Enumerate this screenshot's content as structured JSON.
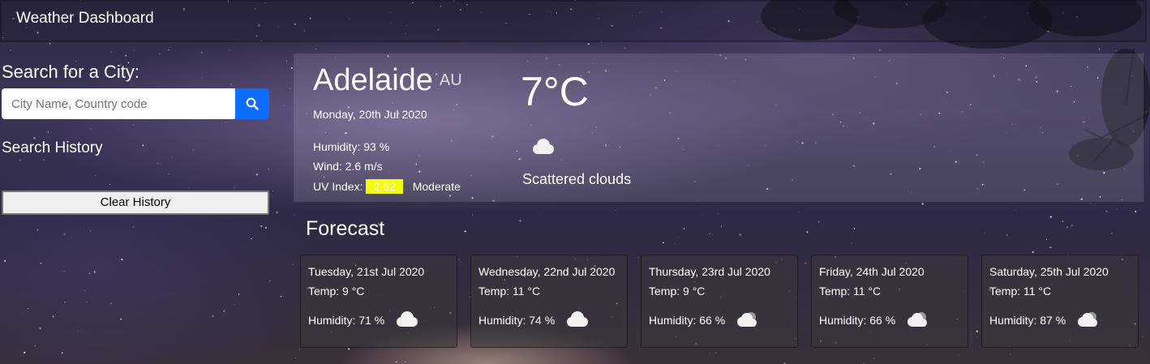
{
  "header": {
    "title": "Weather Dashboard"
  },
  "sidebar": {
    "search_label": "Search for a City:",
    "search_placeholder": "City Name, Country code",
    "search_value": "",
    "search_icon": "search-icon",
    "history_label": "Search History",
    "clear_label": "Clear History"
  },
  "current": {
    "city": "Adelaide",
    "country": "AU",
    "date": "Monday, 20th Jul 2020",
    "humidity": "Humidity: 93 %",
    "wind": "Wind: 2.6 m/s",
    "uv_label": "UV Index:",
    "uv_value": "2.62",
    "uv_level": "Moderate",
    "temp": "7°C",
    "condition": "Scattered clouds",
    "icon": "cloud-icon"
  },
  "forecast": {
    "title": "Forecast",
    "days": [
      {
        "date": "Tuesday, 21st Jul 2020",
        "temp": "Temp: 9 °C",
        "humidity": "Humidity: 71 %",
        "icon": "cloud-icon"
      },
      {
        "date": "Wednesday, 22nd Jul 2020",
        "temp": "Temp: 11 °C",
        "humidity": "Humidity: 74 %",
        "icon": "cloud-icon"
      },
      {
        "date": "Thursday, 23rd Jul 2020",
        "temp": "Temp: 9 °C",
        "humidity": "Humidity: 66 %",
        "icon": "cloud-icon"
      },
      {
        "date": "Friday, 24th Jul 2020",
        "temp": "Temp: 11 °C",
        "humidity": "Humidity: 66 %",
        "icon": "cloud-icon"
      },
      {
        "date": "Saturday, 25th Jul 2020",
        "temp": "Temp: 11 °C",
        "humidity": "Humidity: 87 %",
        "icon": "cloud-icon"
      }
    ]
  },
  "colors": {
    "search_button": "#0d6efd",
    "uv_badge": "#f6ff00"
  }
}
